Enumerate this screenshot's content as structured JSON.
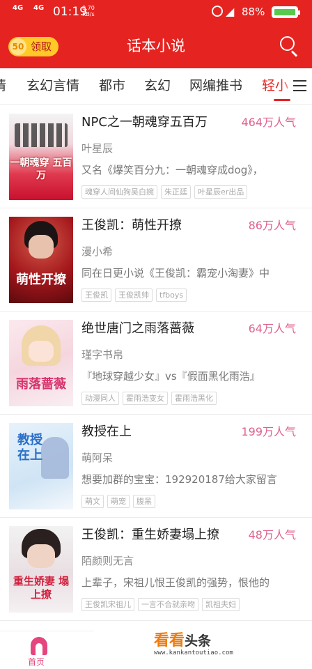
{
  "status_bar": {
    "net1": "4G",
    "net2": "4G",
    "time": "01:19",
    "speed_value": "0.70",
    "speed_unit": "KB/s",
    "battery_percent": "88%",
    "battery_color": "#59c94d"
  },
  "header": {
    "reward_count": "50",
    "reward_label": "领取",
    "title": "话本小说",
    "brand_color": "#e52421"
  },
  "tabs": {
    "items": [
      "情",
      "玄幻言情",
      "都市",
      "玄幻",
      "网编推书",
      "轻小"
    ],
    "active_index": 5
  },
  "books": [
    {
      "title": "NPC之一朝魂穿五百万",
      "popularity": "464万人气",
      "author": "叶星辰",
      "desc": "又名《爆笑百分九：一朝魂穿成dog》，",
      "tags": [
        "魂穿人间仙狗吴白婉",
        "朱正廷",
        "叶星辰er出品"
      ],
      "cover_text": "一朝魂穿 五百万"
    },
    {
      "title": "王俊凯：萌性开撩",
      "popularity": "86万人气",
      "author": "漫小希",
      "desc": "同在日更小说《王俊凯：霸宠小淘妻》中",
      "tags": [
        "王俊凯",
        "王俊凯帅",
        "tfboys"
      ],
      "cover_text": "萌性开撩"
    },
    {
      "title": "绝世唐门之雨落蔷薇",
      "popularity": "64万人气",
      "author": "瑾字书帛",
      "desc": "『地球穿越少女』vs『假面黑化雨浩』",
      "tags": [
        "动漫同人",
        "霍雨浩变女",
        "霍雨浩黑化"
      ],
      "cover_text": "雨落蔷薇"
    },
    {
      "title": "教授在上",
      "popularity": "199万人气",
      "author": "萌阿呆",
      "desc": "想要加群的宝宝：192920187给大家留言",
      "tags": [
        "萌文",
        "萌宠",
        "腹黑"
      ],
      "cover_text": "教授 在上"
    },
    {
      "title": "王俊凯：重生娇妻塌上撩",
      "popularity": "48万人气",
      "author": "陌颜则无言",
      "desc": "上辈子，宋祖儿恨王俊凯的强势，恨他的",
      "tags": [
        "王俊凯宋祖儿",
        "一言不合就亲吻",
        "凯祖夫妇"
      ],
      "cover_text": "重生娇妻 塌上撩"
    }
  ],
  "bottom_nav": {
    "home_label": "首页"
  },
  "watermark": {
    "brand_a": "看看",
    "brand_b": "头条",
    "url": "www.kankantoutiao.com"
  }
}
